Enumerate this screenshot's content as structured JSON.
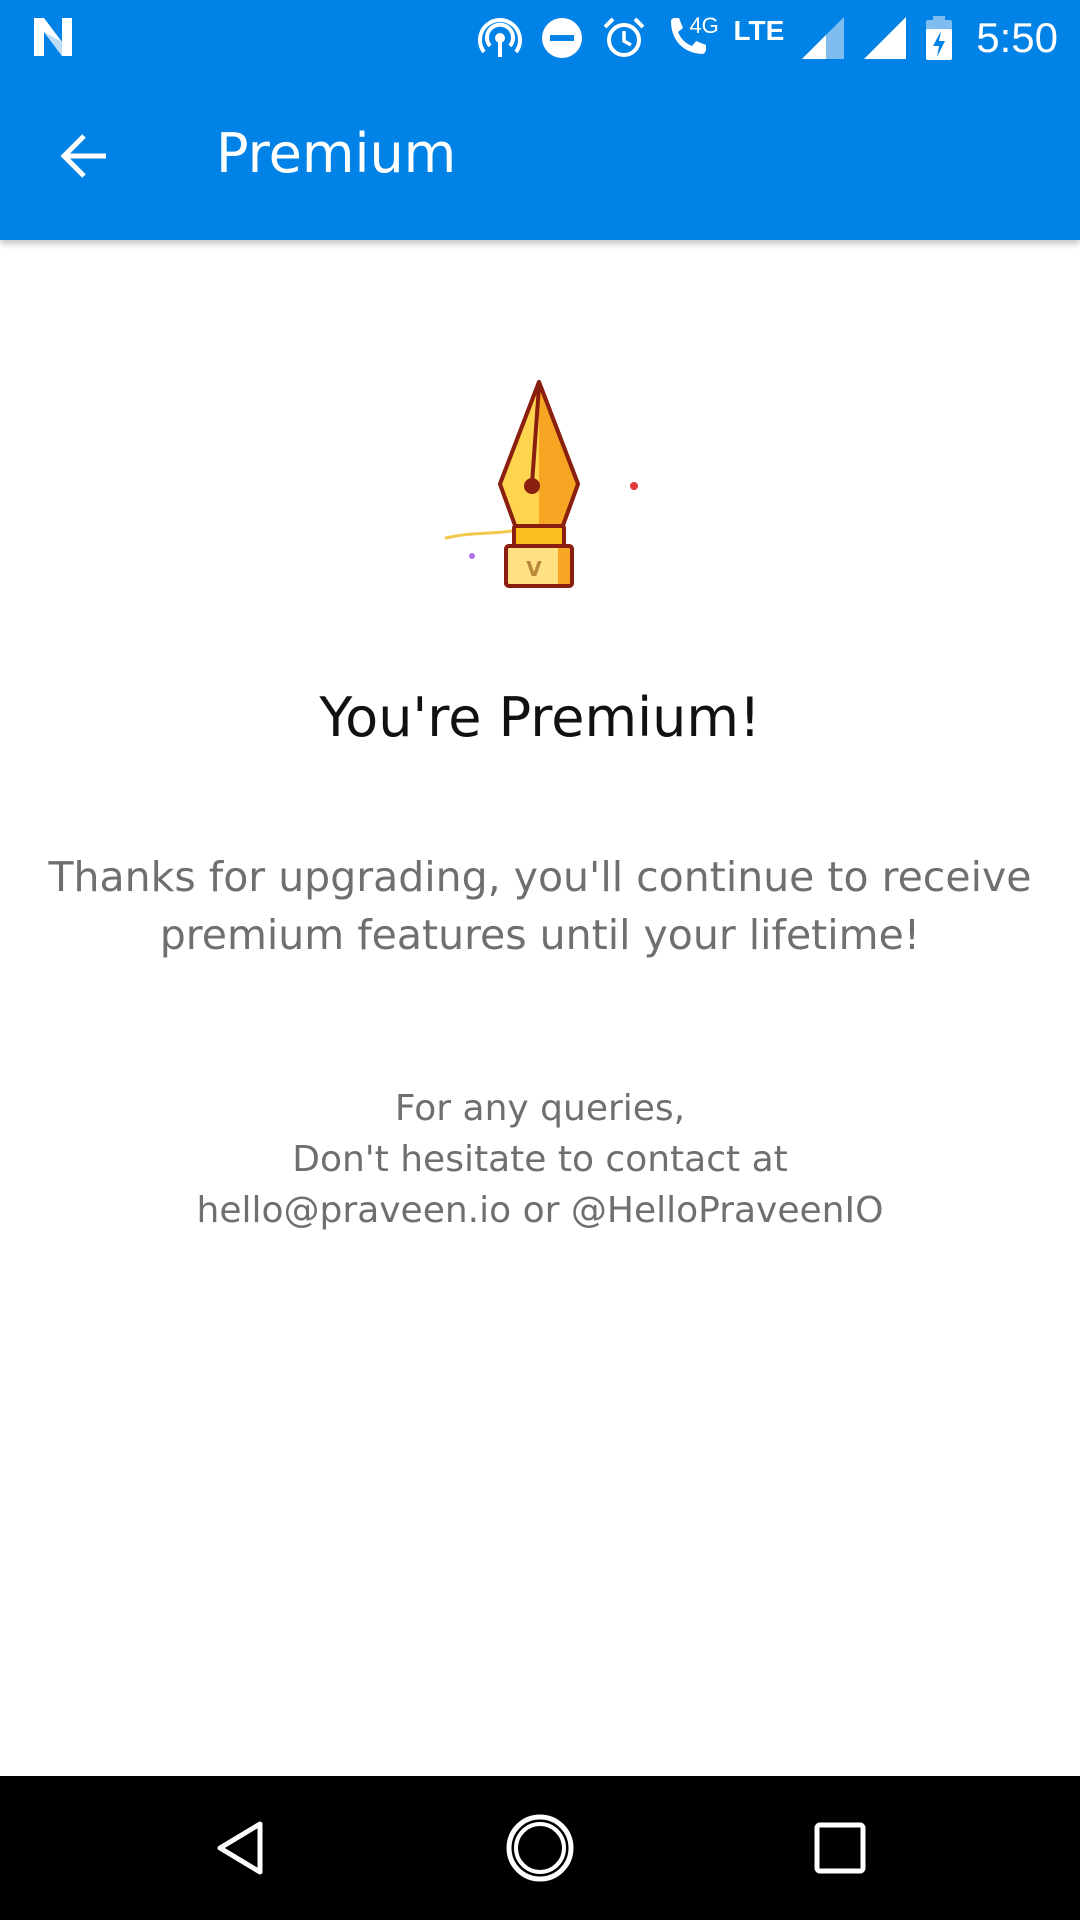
{
  "status_bar": {
    "network_label": "4G",
    "lte_label": "LTE",
    "time": "5:50",
    "icons": [
      "notification-n-icon",
      "hotspot-icon",
      "do-not-disturb-icon",
      "alarm-icon",
      "wifi-calling-icon",
      "signal-icon",
      "signal-full-icon",
      "battery-charging-icon"
    ]
  },
  "app_bar": {
    "title": "Premium",
    "back_icon": "arrow-back-icon",
    "background_color": "#0082e6"
  },
  "content": {
    "illustration_icon": "fountain-pen-nib-icon",
    "illustration_letter": "V",
    "headline": "You're Premium!",
    "thanks_line_1": "Thanks for upgrading, you'll continue to receive",
    "thanks_line_2": "premium features until your lifetime!",
    "contact_line_1": "For any queries,",
    "contact_line_2": "Don't hesitate to contact at",
    "contact_email": "hello@praveen.io",
    "contact_or": " or ",
    "contact_handle": "@HelloPraveenIO"
  },
  "nav_bar": {
    "icons": [
      "back-triangle-icon",
      "home-circle-icon",
      "recents-square-icon"
    ]
  }
}
